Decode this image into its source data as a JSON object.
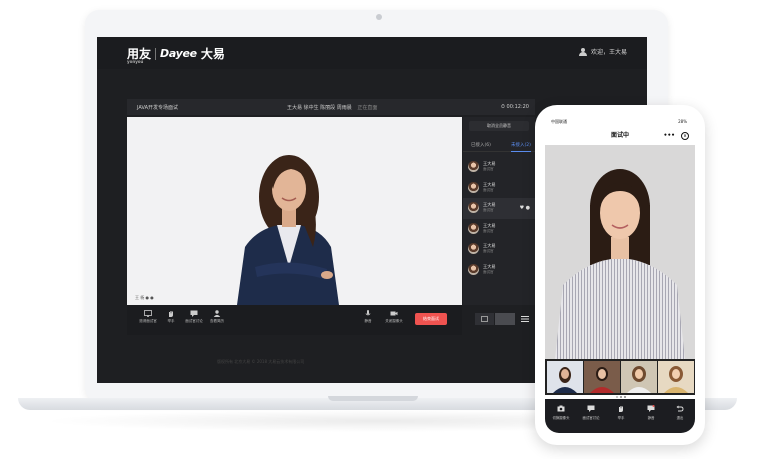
{
  "laptop": {
    "brand": {
      "yonyou": "用友",
      "yonyou_sub": "yonyou",
      "dayee": "Dayee",
      "dayee_cn": "大易"
    },
    "welcome": "欢迎，王大易",
    "meeting": {
      "title": "JAVA开发专场面试",
      "participants": "王大易 徐中生 陈丽段 周雨晨",
      "status": "正在直面",
      "timer": "00:12:20"
    },
    "video_caption": "王 杨 ● ●",
    "controls": [
      {
        "label": "邀请面试官",
        "icon": "screen-share-icon"
      },
      {
        "label": "举手",
        "icon": "hand-icon"
      },
      {
        "label": "面试官讨论",
        "icon": "comment-icon"
      },
      {
        "label": "查看简历",
        "icon": "person-icon"
      },
      {
        "label": "静音",
        "icon": "microphone-icon"
      },
      {
        "label": "关闭摄像头",
        "icon": "camera-icon"
      }
    ],
    "end_button": "结束面试",
    "side_panel": {
      "reset": "取消全员静音",
      "tabs": [
        "已接入(6)",
        "未接入(2)"
      ],
      "members": [
        {
          "name": "王大易",
          "role": "面试官"
        },
        {
          "name": "王大易",
          "role": "面试官"
        },
        {
          "name": "王大易",
          "role": "面试官"
        },
        {
          "name": "王大易",
          "role": "面试官"
        },
        {
          "name": "王大易",
          "role": "面试官"
        },
        {
          "name": "王大易",
          "role": "面试官"
        }
      ]
    },
    "footer": "版权所有 北京大易 © 2018 大易云技术有限公司"
  },
  "phone": {
    "carrier": "中国联通",
    "battery": "28%",
    "title": "面试中",
    "more": "•••",
    "controls": [
      {
        "label": "切换摄像头",
        "icon": "camera-switch-icon"
      },
      {
        "label": "面试官讨论",
        "icon": "comment-icon"
      },
      {
        "label": "举手",
        "icon": "hand-icon"
      },
      {
        "label": "静音",
        "icon": "chat-mute-icon"
      },
      {
        "label": "退出",
        "icon": "exit-icon"
      }
    ]
  }
}
